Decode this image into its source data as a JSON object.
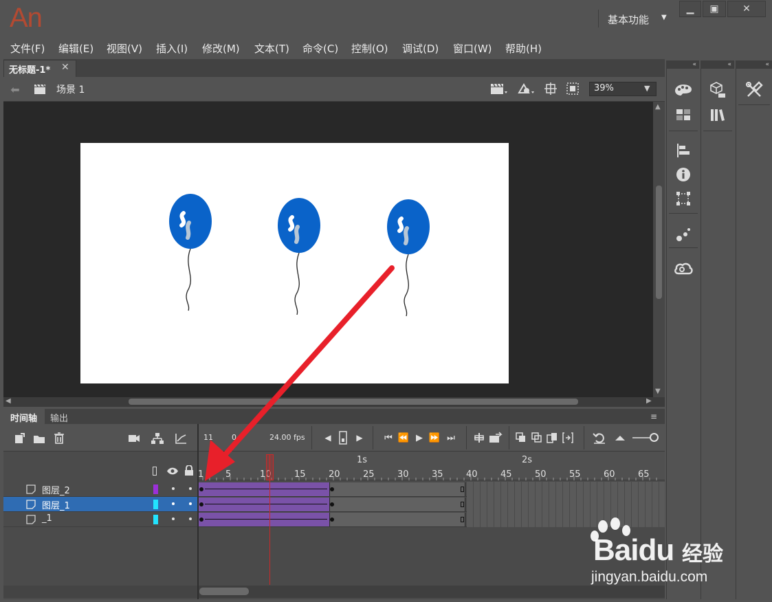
{
  "app": {
    "logo": "An",
    "workspace": "基本功能",
    "colors": {
      "bg": "#535353",
      "logo": "#b34a32",
      "tween": "#7a52a8",
      "playhead": "#c92a2a",
      "arrow": "#e8202a",
      "balloon": "#0a63c9"
    }
  },
  "window_controls": {
    "minimize": "minimize-icon",
    "restore": "restore-icon",
    "close": "close-icon"
  },
  "menu": [
    "文件(F)",
    "编辑(E)",
    "视图(V)",
    "插入(I)",
    "修改(M)",
    "文本(T)",
    "命令(C)",
    "控制(O)",
    "调试(D)",
    "窗口(W)",
    "帮助(H)"
  ],
  "document": {
    "tab_title": "无标题-1*",
    "scene": "场景 1",
    "zoom": "39%"
  },
  "timeline": {
    "tabs": [
      "时间轴",
      "输出"
    ],
    "current_frame": "11",
    "elapsed": "0",
    "fps": "24.00",
    "fps_unit": "fps",
    "ruler_numbers": [
      "1",
      "5",
      "10",
      "15",
      "20",
      "25",
      "30",
      "35",
      "40",
      "45",
      "50",
      "55",
      "60",
      "65"
    ],
    "ruler_seconds": [
      "1s",
      "2s"
    ],
    "layers": [
      {
        "name": "图层_2",
        "color": "#9b30d9",
        "selected": false
      },
      {
        "name": "图层_1",
        "color": "#22e3ff",
        "selected": true
      },
      {
        "name": "_1",
        "color": "#22e3ff",
        "selected": false
      }
    ]
  },
  "panels": {
    "column1": [
      "color-palette-icon",
      "swatches-icon",
      "align-icon",
      "info-icon",
      "transform-icon",
      "motion-presets-icon",
      "creative-cloud-icon"
    ],
    "column2": [
      "properties-icon",
      "library-icon"
    ],
    "column3": [
      "tools-icon"
    ]
  },
  "watermark": {
    "brand_left": "Bai",
    "brand_right": "du",
    "brand_cn": "经验",
    "url": "jingyan.baidu.com"
  }
}
